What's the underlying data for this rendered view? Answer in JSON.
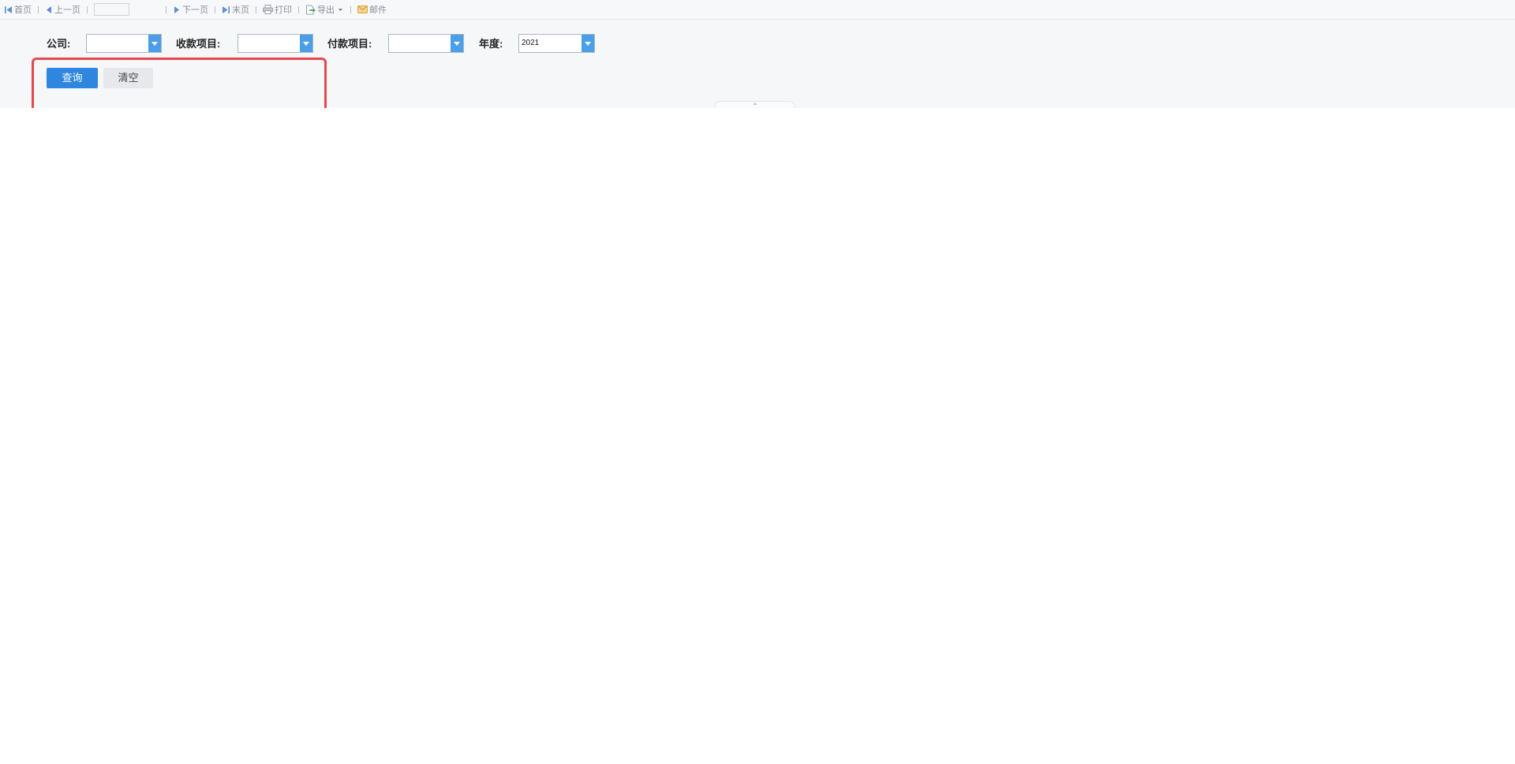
{
  "toolbar": {
    "first_page": "首页",
    "prev_page": "上一页",
    "page_value": "",
    "next_page": "下一页",
    "last_page": "末页",
    "print": "打印",
    "export": "导出",
    "mail": "邮件"
  },
  "filters": {
    "company": {
      "label": "公司:",
      "value": ""
    },
    "income_item": {
      "label": "收款项目:",
      "value": ""
    },
    "payment_item": {
      "label": "付款项目:",
      "value": ""
    },
    "year": {
      "label": "年度:",
      "value": "2021"
    }
  },
  "actions": {
    "query_label": "查询",
    "clear_label": "清空"
  },
  "colors": {
    "accent": "#2e86de",
    "dropdown_arrow": "#4a9fe8",
    "highlight": "#e5484d"
  }
}
